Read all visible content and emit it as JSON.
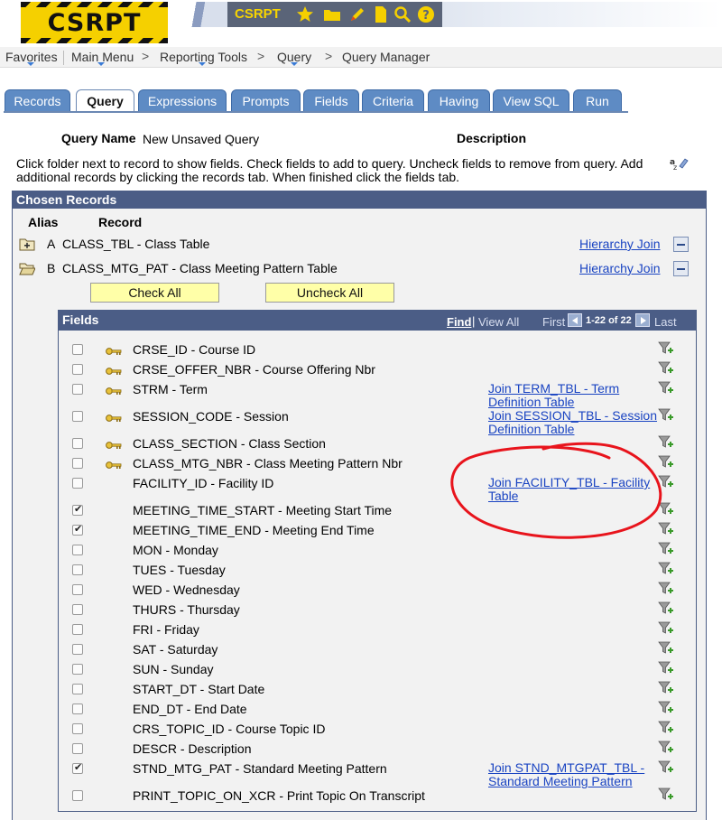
{
  "app": {
    "logo_text": "CSRPT",
    "toolbar_title": "CSRPT"
  },
  "toolbar_icons": [
    "star-icon",
    "folder-icon",
    "pencil-icon",
    "document-icon",
    "search-icon",
    "help-icon"
  ],
  "breadcrumb": {
    "items": [
      "Favorites",
      "Main Menu",
      "Reporting Tools",
      "Query",
      "Query Manager"
    ],
    "separator": ">"
  },
  "tabs": [
    {
      "label": "Records",
      "active": false
    },
    {
      "label": "Query",
      "active": true
    },
    {
      "label": "Expressions",
      "active": false
    },
    {
      "label": "Prompts",
      "active": false
    },
    {
      "label": "Fields",
      "active": false
    },
    {
      "label": "Criteria",
      "active": false
    },
    {
      "label": "Having",
      "active": false
    },
    {
      "label": "View SQL",
      "active": false
    },
    {
      "label": "Run",
      "active": false
    }
  ],
  "query": {
    "name_label": "Query Name",
    "name_value": "New Unsaved Query",
    "description_label": "Description",
    "instructions": "Click folder next to record to show fields. Check fields to add to query. Uncheck fields to remove from query. Add additional records by clicking the records tab. When finished click the fields tab."
  },
  "chosen_records": {
    "title": "Chosen Records",
    "alias_header": "Alias",
    "record_header": "Record",
    "records": [
      {
        "alias": "A",
        "name": "CLASS_TBL - Class Table",
        "join": "Hierarchy Join",
        "expanded": false
      },
      {
        "alias": "B",
        "name": "CLASS_MTG_PAT - Class Meeting Pattern Table",
        "join": "Hierarchy Join",
        "expanded": true
      }
    ],
    "check_all": "Check All",
    "uncheck_all": "Uncheck All"
  },
  "fields_grid": {
    "title": "Fields",
    "find": "Find",
    "separator": "|",
    "view_all": "View All",
    "first": "First",
    "range": "1-22 of 22",
    "last": "Last",
    "rows": [
      {
        "checked": false,
        "key": true,
        "name": "CRSE_ID - Course ID",
        "join": ""
      },
      {
        "checked": false,
        "key": true,
        "name": "CRSE_OFFER_NBR - Course Offering Nbr",
        "join": ""
      },
      {
        "checked": false,
        "key": true,
        "name": "STRM - Term",
        "join": "Join TERM_TBL - Term Definition Table"
      },
      {
        "checked": false,
        "key": true,
        "name": "SESSION_CODE - Session",
        "join": "Join SESSION_TBL - Session Definition Table"
      },
      {
        "checked": false,
        "key": true,
        "name": "CLASS_SECTION - Class Section",
        "join": ""
      },
      {
        "checked": false,
        "key": true,
        "name": "CLASS_MTG_NBR - Class Meeting Pattern Nbr",
        "join": ""
      },
      {
        "checked": false,
        "key": false,
        "name": "FACILITY_ID - Facility ID",
        "join": "Join FACILITY_TBL - Facility Table"
      },
      {
        "checked": true,
        "key": false,
        "name": "MEETING_TIME_START - Meeting Start Time",
        "join": ""
      },
      {
        "checked": true,
        "key": false,
        "name": "MEETING_TIME_END - Meeting End Time",
        "join": ""
      },
      {
        "checked": false,
        "key": false,
        "name": "MON - Monday",
        "join": ""
      },
      {
        "checked": false,
        "key": false,
        "name": "TUES - Tuesday",
        "join": ""
      },
      {
        "checked": false,
        "key": false,
        "name": "WED - Wednesday",
        "join": ""
      },
      {
        "checked": false,
        "key": false,
        "name": "THURS - Thursday",
        "join": ""
      },
      {
        "checked": false,
        "key": false,
        "name": "FRI - Friday",
        "join": ""
      },
      {
        "checked": false,
        "key": false,
        "name": "SAT - Saturday",
        "join": ""
      },
      {
        "checked": false,
        "key": false,
        "name": "SUN - Sunday",
        "join": ""
      },
      {
        "checked": false,
        "key": false,
        "name": "START_DT - Start Date",
        "join": ""
      },
      {
        "checked": false,
        "key": false,
        "name": "END_DT - End Date",
        "join": ""
      },
      {
        "checked": false,
        "key": false,
        "name": "CRS_TOPIC_ID - Course Topic ID",
        "join": ""
      },
      {
        "checked": false,
        "key": false,
        "name": "DESCR - Description",
        "join": ""
      },
      {
        "checked": true,
        "key": false,
        "name": "STND_MTG_PAT - Standard Meeting Pattern",
        "join": "Join STND_MTGPAT_TBL - Standard Meeting Pattern"
      },
      {
        "checked": false,
        "key": false,
        "name": "PRINT_TOPIC_ON_XCR - Print Topic On Transcript",
        "join": ""
      }
    ]
  },
  "colors": {
    "tab_blue": "#5e8bc4",
    "panel_header": "#4b5d86",
    "link": "#1a44c2",
    "button_yellow": "#ffffa8",
    "annotation_red": "#e8141c",
    "logo_yellow": "#f5d000"
  }
}
